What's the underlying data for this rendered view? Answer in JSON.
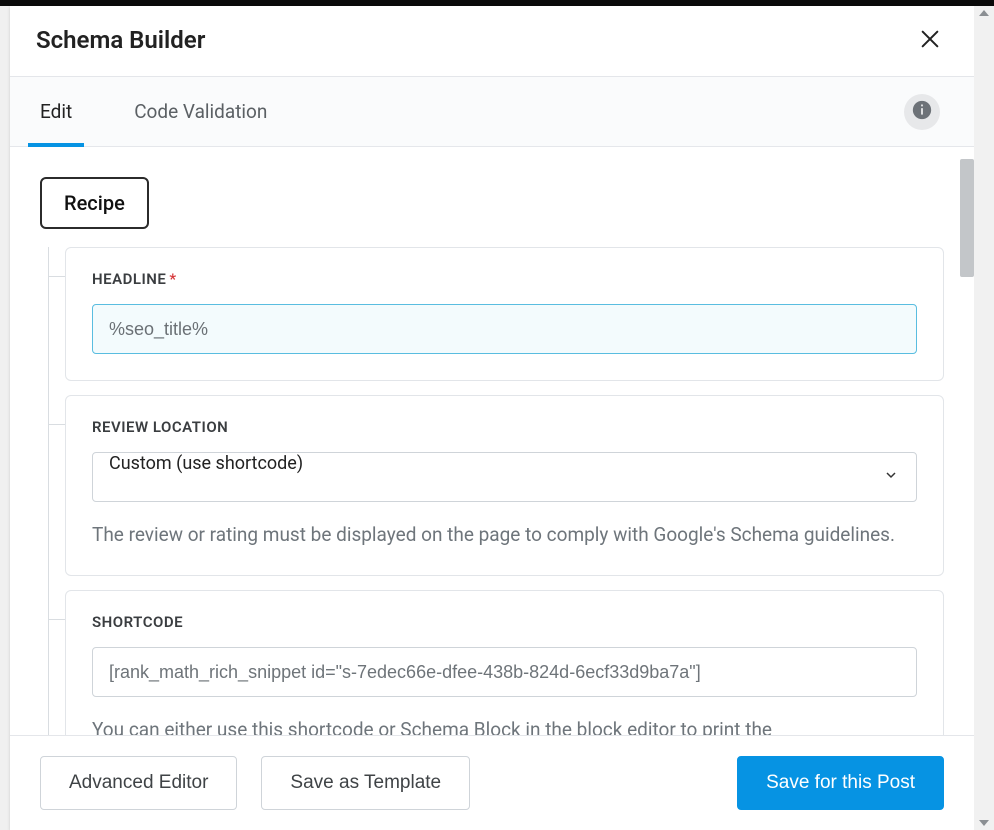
{
  "header": {
    "title": "Schema Builder"
  },
  "tabs": {
    "edit": "Edit",
    "code_validation": "Code Validation"
  },
  "schema_type": "Recipe",
  "fields": {
    "headline": {
      "label": "HEADLINE",
      "value": "%seo_title%"
    },
    "review_location": {
      "label": "REVIEW LOCATION",
      "value": "Custom (use shortcode)",
      "help": "The review or rating must be displayed on the page to comply with Google's Schema guidelines."
    },
    "shortcode": {
      "label": "SHORTCODE",
      "value": "[rank_math_rich_snippet id=\"s-7edec66e-dfee-438b-824d-6ecf33d9ba7a\"]",
      "help": "You can either use this shortcode or Schema Block in the block editor to print the"
    }
  },
  "footer": {
    "advanced": "Advanced Editor",
    "save_template": "Save as Template",
    "save_post": "Save for this Post"
  }
}
